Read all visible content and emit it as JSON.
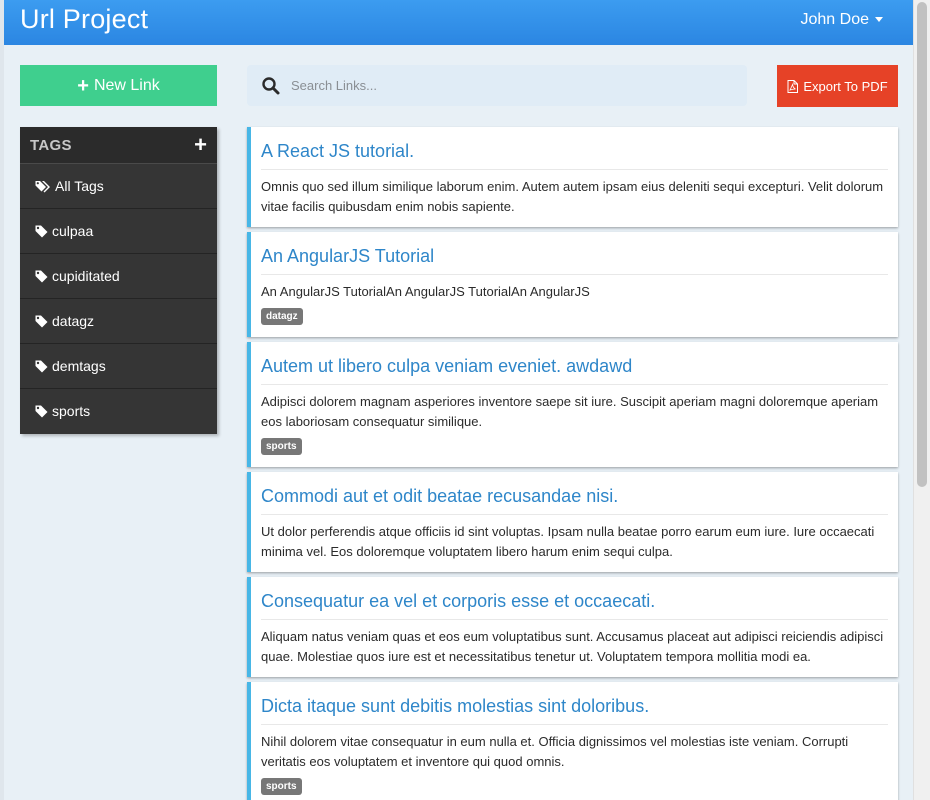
{
  "header": {
    "brand": "Url Project",
    "user": "John Doe"
  },
  "actions": {
    "new_link": "New Link",
    "search_placeholder": "Search Links...",
    "export": "Export To PDF"
  },
  "tags": {
    "title": "TAGS",
    "items": [
      {
        "label": "All Tags"
      },
      {
        "label": "culpaa"
      },
      {
        "label": "cupiditated"
      },
      {
        "label": "datagz"
      },
      {
        "label": "demtags"
      },
      {
        "label": "sports"
      }
    ]
  },
  "links": [
    {
      "title": "A React JS tutorial.",
      "description": "Omnis quo sed illum similique laborum enim. Autem autem ipsam eius deleniti sequi excepturi. Velit dolorum vitae facilis quibusdam enim nobis sapiente.",
      "tag": ""
    },
    {
      "title": "An AngularJS Tutorial",
      "description": "An AngularJS TutorialAn AngularJS TutorialAn AngularJS",
      "tag": "datagz"
    },
    {
      "title": "Autem ut libero culpa veniam eveniet. awdawd",
      "description": "Adipisci dolorem magnam asperiores inventore saepe sit iure. Suscipit aperiam magni doloremque aperiam eos laboriosam consequatur similique.",
      "tag": "sports"
    },
    {
      "title": "Commodi aut et odit beatae recusandae nisi.",
      "description": "Ut dolor perferendis atque officiis id sint voluptas. Ipsam nulla beatae porro earum eum iure. Iure occaecati minima vel. Eos doloremque voluptatem libero harum enim sequi culpa.",
      "tag": ""
    },
    {
      "title": "Consequatur ea vel et corporis esse et occaecati.",
      "description": "Aliquam natus veniam quas et eos eum voluptatibus sunt. Accusamus placeat aut adipisci reiciendis adipisci quae. Molestiae quos iure est et necessitatibus tenetur ut. Voluptatem tempora mollitia modi ea.",
      "tag": ""
    },
    {
      "title": "Dicta itaque sunt debitis molestias sint doloribus.",
      "description": "Nihil dolorem vitae consequatur in eum nulla et. Officia dignissimos vel molestias iste veniam. Corrupti veritatis eos voluptatem et inventore qui quod omnis.",
      "tag": "sports"
    }
  ],
  "colors": {
    "navbar": "#2f8ee8",
    "new_link": "#3fcf8e",
    "export": "#e64227",
    "card_accent": "#47b6e6",
    "link_title": "#2e86c9",
    "sidebar": "#353535"
  }
}
